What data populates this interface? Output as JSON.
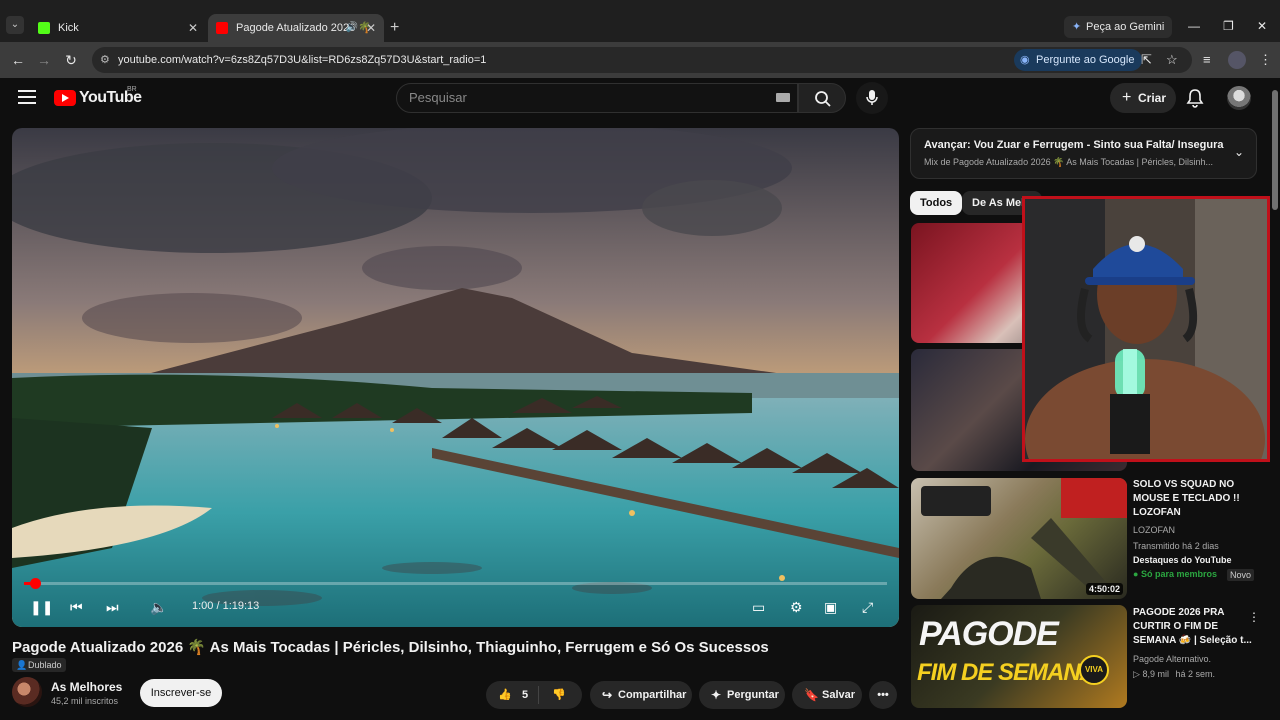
{
  "browser": {
    "tabs": [
      {
        "label": "Kick",
        "favicon_color": "#53fc18"
      },
      {
        "label": "Pagode Atualizado 2026 🌴",
        "favicon_color": "#ff0000"
      }
    ],
    "gemini_label": "Peça ao Gemini",
    "url": "youtube.com/watch?v=6zs8Zq57D3U&list=RD6zs8Zq57D3U&start_radio=1",
    "ask_google_label": "Pergunte ao Google",
    "window_controls": [
      "—",
      "❐",
      "✕"
    ]
  },
  "youtube": {
    "logo_word": "YouTube",
    "logo_region": "BR",
    "search_placeholder": "Pesquisar",
    "create_label": "Criar"
  },
  "player": {
    "time_display": "1:00 / 1:19:13",
    "progress_fraction": 0.013
  },
  "video": {
    "title": "Pagode Atualizado 2026 🌴 As Mais Tocadas | Péricles, Dilsinho, Thiaguinho, Ferrugem e Só Os Sucessos",
    "dub_label": "Dublado",
    "channel_name": "As Melhores",
    "channel_subs": "45,2 mil inscritos",
    "subscribe_label": "Inscrever-se",
    "like_count": "5",
    "share_label": "Compartilhar",
    "ask_label": "Perguntar",
    "save_label": "Salvar"
  },
  "sidebar": {
    "up_next_title": "Avançar: Vou Zuar e Ferrugem - Sinto sua Falta/ Insegurança...",
    "up_next_sub": "Mix de Pagode Atualizado 2026 🌴 As Mais Tocadas | Péricles, Dilsinh...",
    "chips": [
      "Todos",
      "De As Melhores"
    ],
    "videos": [
      {
        "title": "SOLO VS SQUAD NO MOUSE E TECLADO !! LOZOFAN",
        "channel": "LOZOFAN",
        "meta": "Transmitido há 2 dias",
        "tag": "Destaques do YouTube",
        "members": "Só para membros",
        "badge": "Novo",
        "duration": "4:50:02"
      },
      {
        "title": "PAGODE 2026 PRA CURTIR O FIM DE SEMANA 🍻 | Seleção t...",
        "channel": "Pagode Alternativo.",
        "meta_views": "8,9 mil",
        "meta_age": "há 2 sem.",
        "thumb_text_1": "PAGODE",
        "thumb_text_2": "FIM DE SEMANA",
        "thumb_badge": "VIVA"
      }
    ]
  },
  "colors": {
    "brand_red": "#ff0000",
    "webcam_border": "#c0101a",
    "members_green": "#2ba640"
  }
}
